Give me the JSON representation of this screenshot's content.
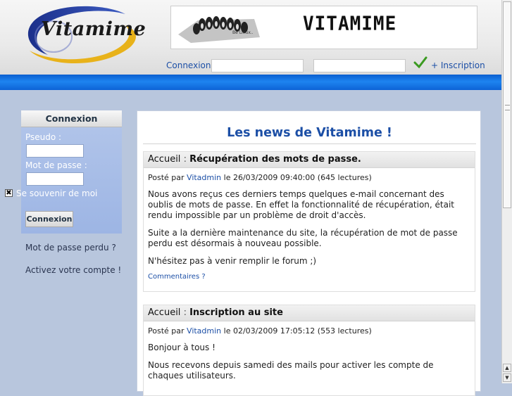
{
  "header": {
    "logo_text": "Vitamime",
    "banner_tag": "Be Linux..",
    "banner_brand": "VITAMIME",
    "top_login_label": "Connexion",
    "inscription_link": "+ Inscription"
  },
  "sidebar": {
    "title": "Connexion",
    "pseudo_label": "Pseudo :",
    "password_label": "Mot de passe :",
    "remember_label": "Se souvenir de moi",
    "remember_checked": true,
    "login_button": "Connexion",
    "forgot_link": "Mot de passe perdu ?",
    "activate_link": "Activez votre compte !"
  },
  "main": {
    "title": "Les news de Vitamime !",
    "articles": [
      {
        "category": "Accueil",
        "separator": ":",
        "title": "Récupération des mots de passe.",
        "posted_by": "Posté par",
        "author": "Vitadmin",
        "meta_rest": "le 26/03/2009 09:40:00 (645 lectures)",
        "paragraphs": [
          "Nous avons reçus ces derniers temps quelques e-mail concernant des oublis de mots de passe. En effet la fonctionnalité de récupération, était rendu impossible par un problème de droit d'accès.",
          "Suite a la dernière maintenance du site, la récupération de mot de passe perdu est désormais à nouveau possible.",
          "N'hésitez pas à venir remplir le forum ;)"
        ],
        "comments": "Commentaires ?"
      },
      {
        "category": "Accueil",
        "separator": ":",
        "title": "Inscription au site",
        "posted_by": "Posté par",
        "author": "Vitadmin",
        "meta_rest": "le 02/03/2009 17:05:12 (553 lectures)",
        "paragraphs": [
          "Bonjour à tous !",
          "Nous recevons depuis samedi des mails pour activer les compte de chaques utilisateurs."
        ]
      }
    ]
  },
  "colors": {
    "link": "#1c4fa6",
    "blue_bar": "#1e84f0",
    "page_bg": "#b8c6dd"
  }
}
